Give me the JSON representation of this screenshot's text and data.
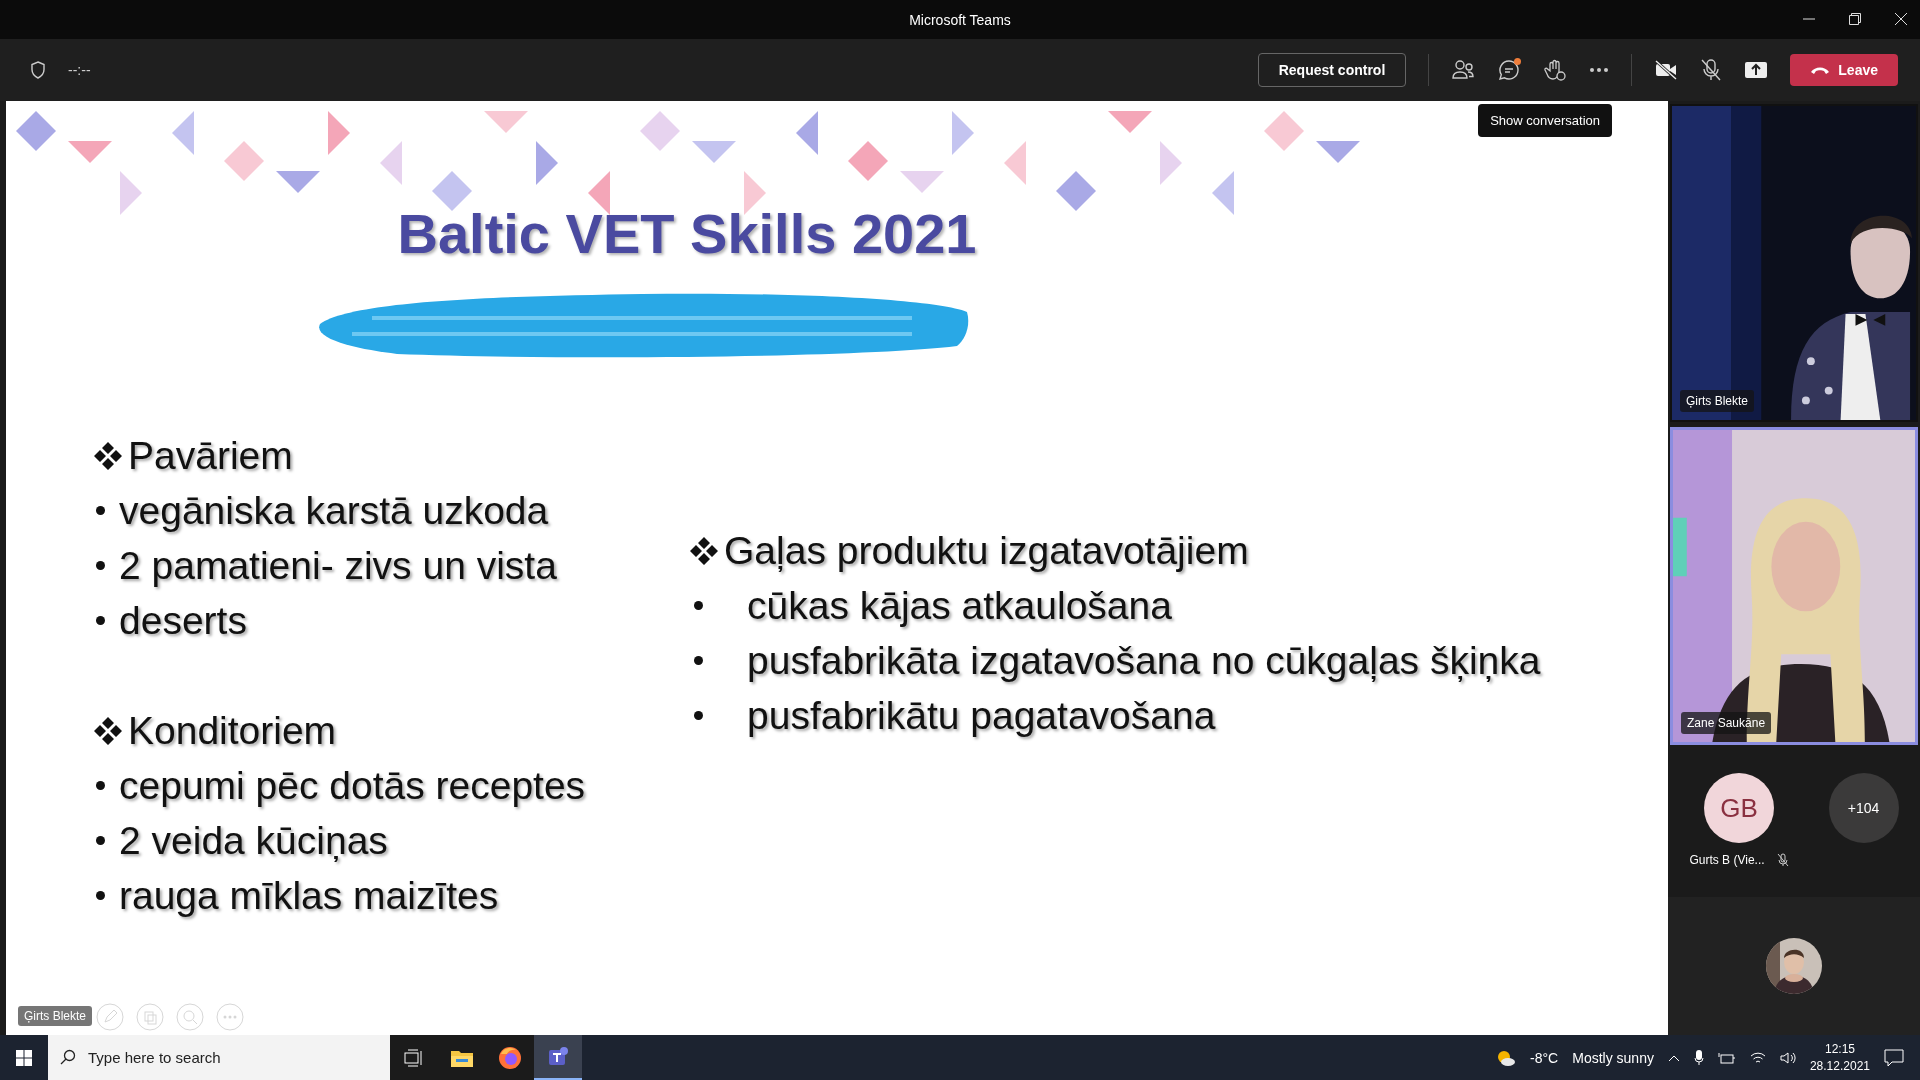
{
  "window": {
    "title": "Microsoft Teams"
  },
  "meeting_bar": {
    "timer": "--:--",
    "request_control": "Request control",
    "chat_unread": true,
    "leave": "Leave",
    "tooltip": "Show conversation"
  },
  "slide": {
    "title": "Baltic VET Skills 2021",
    "columns": [
      {
        "sections": [
          {
            "heading": "Pavāriem",
            "items": [
              "vegāniska karstā uzkoda",
              "2 pamatieni- zivs un vista",
              "deserts"
            ]
          },
          {
            "heading": "Konditoriem",
            "items": [
              "cepumi pēc dotās receptes",
              "2 veida kūciņas",
              "rauga mīklas maizītes"
            ]
          }
        ]
      },
      {
        "sections": [
          {
            "heading": "Gaļas produktu izgatavotājiem",
            "items": [
              "cūkas kājas atkaulošana",
              "pusfabrikāta izgatavošana no cūkgaļas šķiņka",
              "pusfabrikātu pagatavošana"
            ]
          }
        ]
      }
    ],
    "presenter": "Ģirts Blekte"
  },
  "participants": [
    {
      "name": "Ģirts Blekte",
      "kind": "picture",
      "speaking": false
    },
    {
      "name": "Zane Saukāne",
      "kind": "picture",
      "speaking": true
    }
  ],
  "roster": {
    "initials": "GB",
    "name": "Gurts B (Vie...",
    "muted": true,
    "overflow": "+104"
  },
  "taskbar": {
    "search_placeholder": "Type here to search",
    "apps": [
      {
        "kind": "taskview",
        "active": false
      },
      {
        "kind": "explorer",
        "active": false
      },
      {
        "kind": "firefox",
        "active": false
      },
      {
        "kind": "teams",
        "active": true
      }
    ],
    "temperature": "-8°C",
    "weather": "Mostly sunny",
    "time": "12:15",
    "date": "28.12.2021"
  }
}
